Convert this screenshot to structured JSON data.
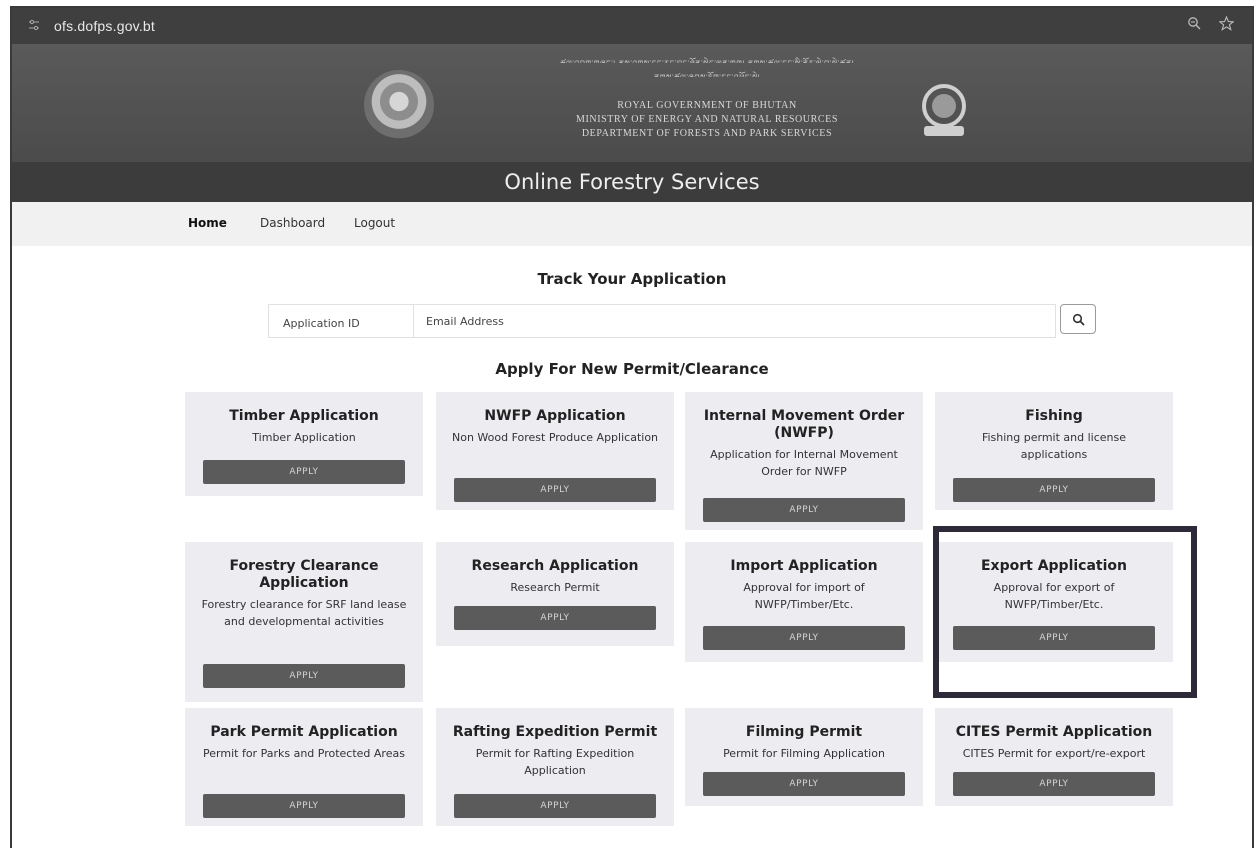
{
  "browser": {
    "url": "ofs.dofps.gov.bt",
    "icons": [
      "site-settings-icon",
      "zoom-icon",
      "bookmark-star-icon"
    ]
  },
  "header": {
    "dzongkha_line1": "ཚལ་འབྲུག་གཞུང་། ནུས་ཤུགས་དང་རང་བྱུང་ཐོན་སྐྱེད་ལྷན་ཁག། ནགས་ཚལ་དང་སྤྱི་ནོར་ལྟེ་བ་སྡེ་ཚན།",
    "dzongkha_line2": "ནགས་ཚལ་ཞབས་ཏོག་དང་འཕྲོད་སྡེ།",
    "org_line1": "ROYAL GOVERNMENT OF BHUTAN",
    "org_line2": "MINISTRY OF ENERGY AND NATURAL RESOURCES",
    "org_line3": "DEPARTMENT OF FORESTS AND PARK SERVICES",
    "title": "Online Forestry Services"
  },
  "nav": {
    "items": [
      {
        "label": "Home",
        "active": true
      },
      {
        "label": "Dashboard",
        "active": false
      },
      {
        "label": "Logout",
        "active": false
      }
    ]
  },
  "track": {
    "title": "Track Your Application",
    "id_placeholder": "Application ID",
    "email_placeholder": "Email Address",
    "search_icon": "search-icon"
  },
  "apply": {
    "title": "Apply For New Permit/Clearance",
    "button_label": "APPLY",
    "cards": [
      {
        "title": "Timber Application",
        "desc": "Timber Application"
      },
      {
        "title": "NWFP Application",
        "desc": "Non Wood Forest Produce Application"
      },
      {
        "title": "Internal Movement Order (NWFP)",
        "desc": "Application for Internal Movement Order for NWFP"
      },
      {
        "title": "Fishing",
        "desc": "Fishing permit and license applications"
      },
      {
        "title": "Forestry Clearance Application",
        "desc": "Forestry clearance for SRF land lease and developmental activities"
      },
      {
        "title": "Research Application",
        "desc": "Research Permit"
      },
      {
        "title": "Import Application",
        "desc": "Approval for import of NWFP/Timber/Etc."
      },
      {
        "title": "Export Application",
        "desc": "Approval for export of NWFP/Timber/Etc."
      },
      {
        "title": "Park Permit Application",
        "desc": "Permit for Parks and Protected Areas"
      },
      {
        "title": "Rafting Expedition Permit",
        "desc": "Permit for Rafting Expedition Application"
      },
      {
        "title": "Filming Permit",
        "desc": "Permit for Filming Application"
      },
      {
        "title": "CITES Permit Application",
        "desc": "CITES Permit for export/re-export"
      }
    ]
  }
}
